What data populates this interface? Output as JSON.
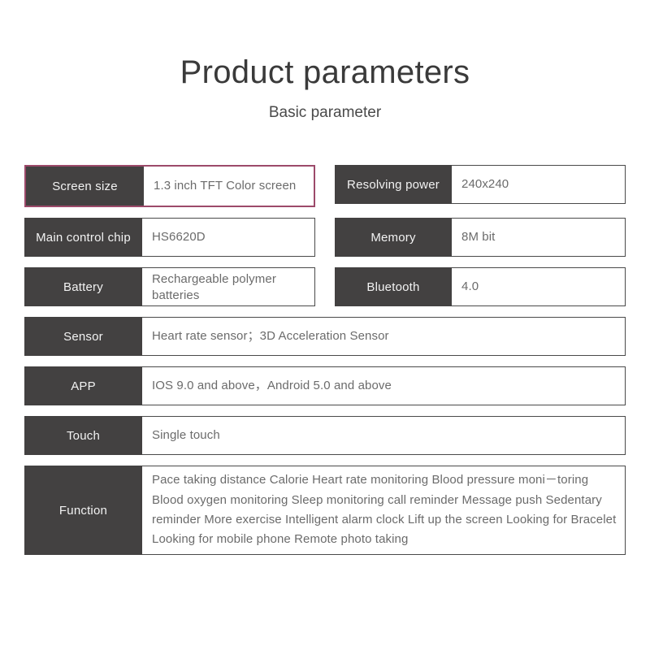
{
  "header": {
    "title": "Product parameters",
    "subtitle": "Basic parameter"
  },
  "theme": {
    "label_bg": "#434141",
    "label_text": "#f2f2f2",
    "value_text": "#6b6b6b",
    "highlight_border": "#9c4a6a",
    "cell_border": "#4a4a4a",
    "page_bg": "#ffffff"
  },
  "specs": {
    "screen_size": {
      "label": "Screen size",
      "value": "1.3  inch TFT Color screen"
    },
    "resolving_power": {
      "label": "Resolving power",
      "value": "240x240"
    },
    "main_control_chip": {
      "label": "Main control chip",
      "value": "HS6620D"
    },
    "memory": {
      "label": "Memory",
      "value": "8M bit"
    },
    "battery": {
      "label": "Battery",
      "value": "Rechargeable polymer batteries"
    },
    "bluetooth": {
      "label": "Bluetooth",
      "value": "4.0"
    },
    "sensor": {
      "label": "Sensor",
      "value": "Heart rate sensor；3D Acceleration Sensor"
    },
    "app": {
      "label": "APP",
      "value": "IOS 9.0 and above，Android 5.0 and above"
    },
    "touch": {
      "label": "Touch",
      "value": "Single touch"
    },
    "function": {
      "label": "Function",
      "value": "Pace taking  distance  Calorie  Heart rate monitoring  Blood pressure moni－toring  Blood oxygen monitoring  Sleep monitoring  call reminder  Message push  Sedentary reminder  More exercise  Intelligent alarm clock Lift up the screen  Looking for Bracelet  Looking for mobile phone  Remote photo taking"
    }
  }
}
